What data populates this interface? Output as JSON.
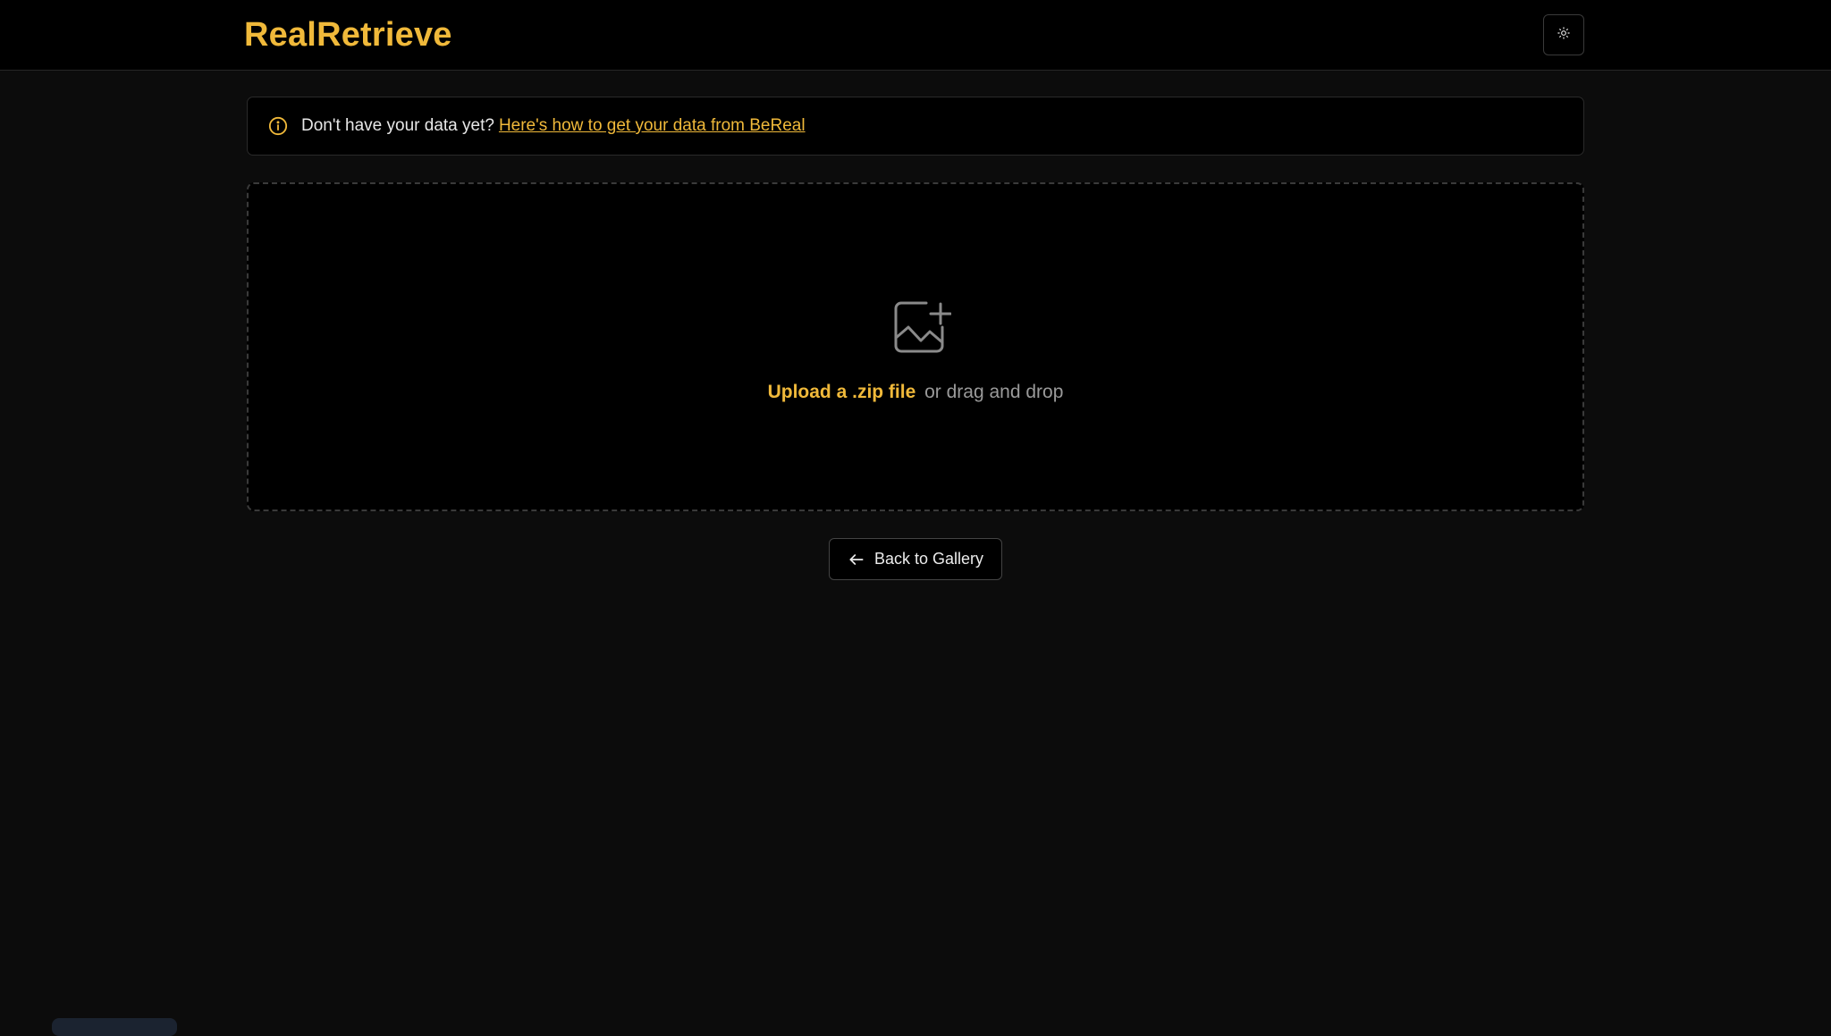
{
  "header": {
    "brand": "RealRetrieve",
    "theme_toggle_icon": "sun-icon"
  },
  "banner": {
    "icon": "info-icon",
    "text": "Don't have your data yet?",
    "link_text": "Here's how to get your data from BeReal"
  },
  "dropzone": {
    "icon": "image-plus-icon",
    "upload_link": "Upload a .zip file",
    "drag_text": "or drag and drop"
  },
  "actions": {
    "back_label": "Back to Gallery",
    "back_icon": "arrow-left-icon"
  },
  "colors": {
    "accent": "#f0b93a",
    "background": "#0c0c0c",
    "surface": "#000000",
    "border": "#2a2a2a",
    "muted_text": "#9a9a9a"
  }
}
